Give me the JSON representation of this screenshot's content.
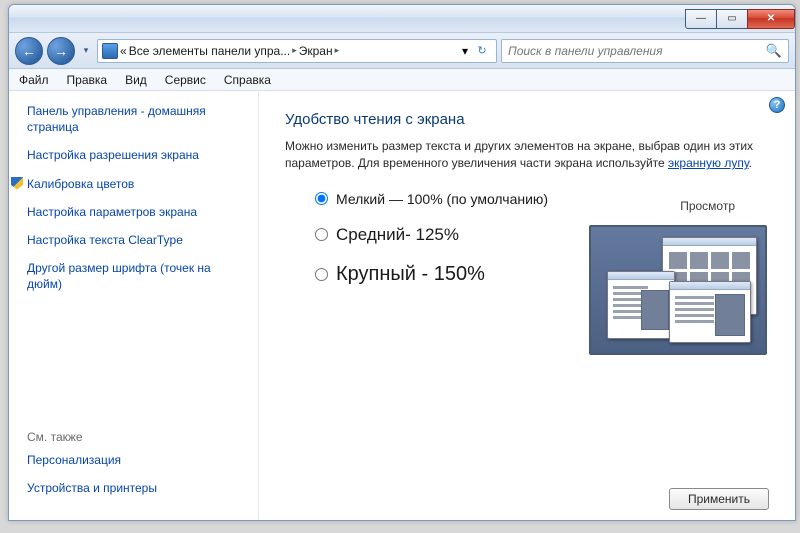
{
  "window": {
    "min_glyph": "—",
    "max_glyph": "▭",
    "close_glyph": "✕"
  },
  "nav": {
    "back_glyph": "←",
    "fwd_glyph": "→",
    "history_glyph": "▾",
    "chevrons": "«",
    "crumb1": "Все элементы панели упра...",
    "crumb2": "Экран",
    "sep1": "▸",
    "sep2": "▸",
    "dropdown": "▾",
    "refresh": "↻"
  },
  "search": {
    "placeholder": "Поиск в панели управления",
    "icon": "🔍"
  },
  "menu": {
    "file": "Файл",
    "edit": "Правка",
    "view": "Вид",
    "tools": "Сервис",
    "help": "Справка"
  },
  "help_glyph": "?",
  "sidebar": {
    "home": "Панель управления - домашняя страница",
    "res": "Настройка разрешения экрана",
    "calib": "Калибровка цветов",
    "params": "Настройка параметров экрана",
    "cleartype": "Настройка текста ClearType",
    "dpi": "Другой размер шрифта (точек на дюйм)",
    "see_also": "См. также",
    "personalize": "Персонализация",
    "devices": "Устройства и принтеры"
  },
  "main": {
    "heading": "Удобство чтения с экрана",
    "desc_pre": "Можно изменить размер текста и других элементов на экране, выбрав один из этих параметров. Для временного увеличения части экрана используйте ",
    "desc_link": "экранную лупу",
    "desc_post": ".",
    "opt_small": "Мелкий — 100% (по умолчанию)",
    "opt_medium": "Средний- 125%",
    "opt_large": "Крупный - 150%",
    "preview": "Просмотр",
    "apply": "Применить"
  }
}
